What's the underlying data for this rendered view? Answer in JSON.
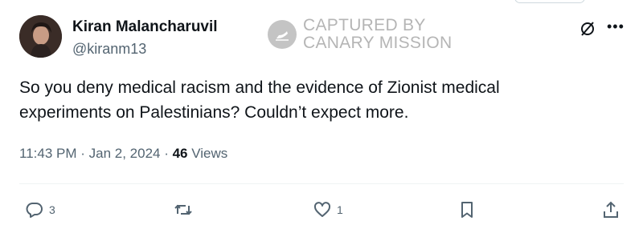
{
  "author": {
    "display_name": "Kiran Malancharuvil",
    "handle": "@kiranm13"
  },
  "watermark": {
    "line1": "CAPTURED BY",
    "line2": "CANARY MISSION"
  },
  "tweet": {
    "text": "So you deny medical racism and the evidence of Zionist medical experiments on Palestinians? Couldn’t expect more.",
    "time": "11:43 PM",
    "separator1": " · ",
    "date": "Jan 2, 2024",
    "separator2": " · ",
    "views_count": "46",
    "views_label": " Views"
  },
  "actions": {
    "reply_count": "3",
    "retweet_count": "",
    "like_count": "1"
  },
  "icons": {
    "header": [
      "grok-icon",
      "more-icon"
    ],
    "actions": [
      "reply-icon",
      "retweet-icon",
      "like-icon",
      "bookmark-icon",
      "share-icon"
    ]
  },
  "colors": {
    "text_primary": "#0f1419",
    "text_secondary": "#536471",
    "watermark": "#b5b5b5",
    "divider": "#eff3f4"
  }
}
